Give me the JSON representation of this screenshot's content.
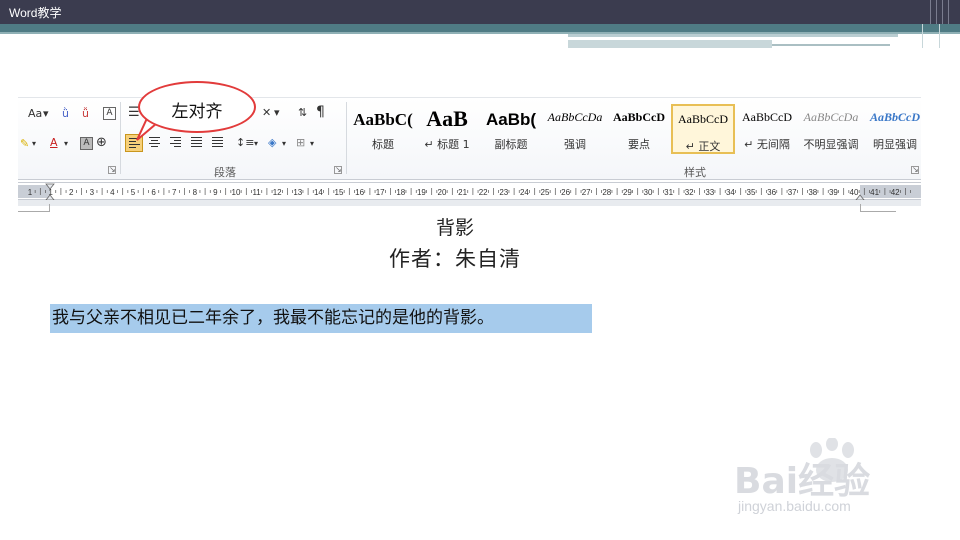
{
  "header": {
    "title": "Word教学"
  },
  "ribbon": {
    "font_size_label": "Aa",
    "paragraph_label": "段落",
    "styles_label": "样式",
    "styles": [
      {
        "sample": "AaBbC(",
        "name": "标题"
      },
      {
        "sample": "AaB",
        "name": "↵ 标题 1"
      },
      {
        "sample": "AaBb(",
        "name": "副标题"
      },
      {
        "sample": "AaBbCcDa",
        "name": "强调"
      },
      {
        "sample": "AaBbCcD",
        "name": "要点"
      },
      {
        "sample": "AaBbCcD",
        "name": "↵ 正文"
      },
      {
        "sample": "AaBbCcD",
        "name": "↵ 无间隔"
      },
      {
        "sample": "AaBbCcDa",
        "name": "不明显强调"
      },
      {
        "sample": "AaBbCcD",
        "name": "明显强调"
      }
    ],
    "current_style_index": 5
  },
  "callout": {
    "text": "左对齐"
  },
  "ruler": {
    "ticks": [
      "1",
      "1",
      "2",
      "3",
      "4",
      "5",
      "6",
      "7",
      "8",
      "9",
      "10",
      "11",
      "12",
      "13",
      "14",
      "15",
      "16",
      "17",
      "18",
      "19",
      "20",
      "21",
      "22",
      "23",
      "24",
      "25",
      "26",
      "27",
      "28",
      "29",
      "30",
      "31",
      "32",
      "33",
      "34",
      "35",
      "36",
      "37",
      "38",
      "39",
      "40",
      "41",
      "42"
    ]
  },
  "document": {
    "title": "背影",
    "author": "作者：朱自清",
    "paragraph": "我与父亲不相见已二年余了，我最不能忘记的是他的背影。"
  },
  "watermark": {
    "main": "Bai经验",
    "sub": "jingyan.baidu.com"
  },
  "colors": {
    "header_bg": "#3b3c4f",
    "teal": "#4f7b84",
    "selection": "#a6cbec",
    "callout_border": "#e23b3b",
    "active_button": "#f6d07a"
  }
}
